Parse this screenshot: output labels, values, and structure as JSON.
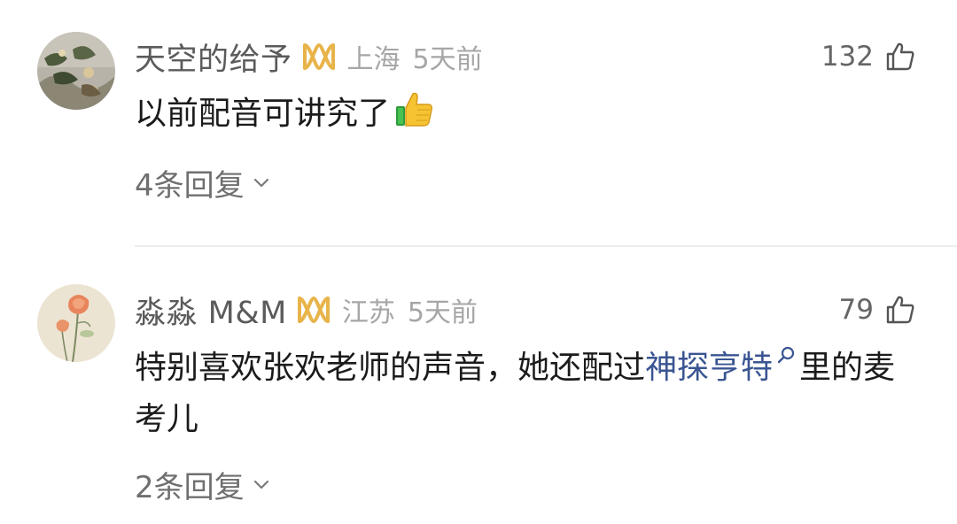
{
  "comments": [
    {
      "username": "天空的给予",
      "location": "上海",
      "time": "5天前",
      "likes": "132",
      "text": "以前配音可讲究了",
      "emoji": "thumbs-up-emoji",
      "replies": "4条回复"
    },
    {
      "username": "淼淼 M&M",
      "location": "江苏",
      "time": "5天前",
      "likes": "79",
      "text_before": "特别喜欢张欢老师的声音，她还配过",
      "topic": "神探亨特",
      "text_after": "里的麦考儿",
      "replies": "2条回复"
    }
  ],
  "icons": {
    "vip": "vip-icon",
    "like": "thumbs-up-icon",
    "topic": "search-icon",
    "expand": "chevron-down-icon"
  },
  "colors": {
    "username": "#5b5b5b",
    "meta": "#a6a6a6",
    "text": "#1b1b1b",
    "link": "#3a5592",
    "vip_gold": "#e8b44a"
  }
}
